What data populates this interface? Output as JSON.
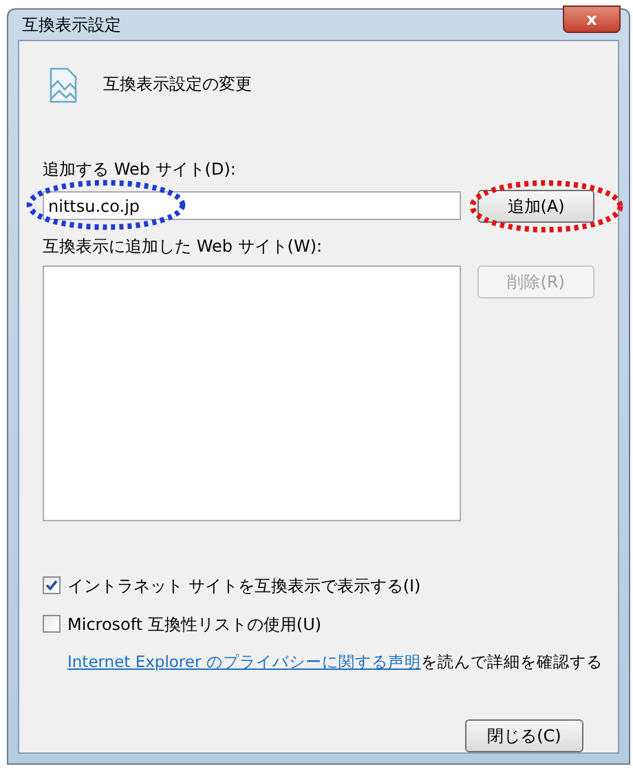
{
  "window": {
    "title": "互換表示設定",
    "close": "x"
  },
  "header": {
    "title": "互換表示設定の変更"
  },
  "add_section": {
    "label": "追加する Web サイト(D):",
    "field": {
      "value": "nittsu.co.jp",
      "annotation": {
        "color": "#1e3cd2"
      }
    },
    "button": {
      "label": "追加(A)",
      "disabled": false,
      "annotation": {
        "color": "#e01414"
      }
    }
  },
  "list_section": {
    "label": "互換表示に追加した Web サイト(W):",
    "button": {
      "label": "削除(R)",
      "disabled": true
    }
  },
  "options": [
    {
      "label": "イントラネット サイトを互換表示で表示する(I)",
      "checked": true
    },
    {
      "label": "Microsoft 互換性リストの使用(U)",
      "checked": false
    }
  ],
  "privacy": {
    "link": "Internet Explorer のプライバシーに関する声明",
    "text": "を読んで詳細を確認する"
  },
  "footer": {
    "button": {
      "label": "閉じる(C)"
    }
  }
}
